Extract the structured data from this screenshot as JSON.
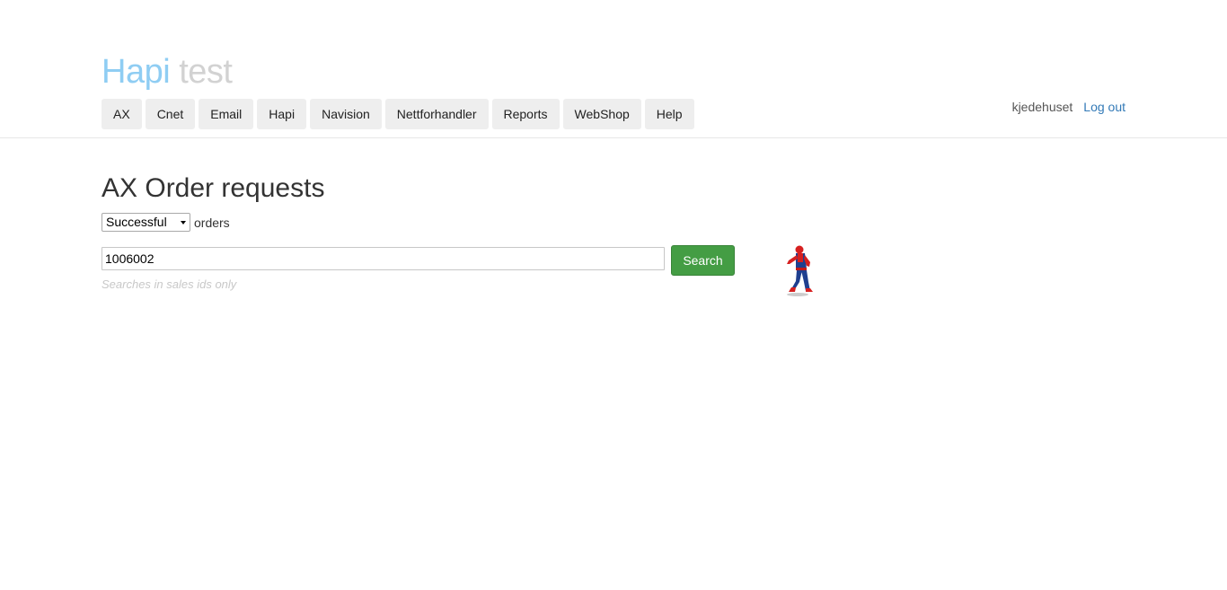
{
  "brand": {
    "primary": "Hapi",
    "secondary": "test"
  },
  "nav": {
    "items": [
      {
        "label": "AX"
      },
      {
        "label": "Cnet"
      },
      {
        "label": "Email"
      },
      {
        "label": "Hapi"
      },
      {
        "label": "Navision"
      },
      {
        "label": "Nettforhandler"
      },
      {
        "label": "Reports"
      },
      {
        "label": "WebShop"
      },
      {
        "label": "Help"
      }
    ]
  },
  "user": {
    "name": "kjedehuset",
    "logout_label": "Log out"
  },
  "page": {
    "title": "AX Order requests"
  },
  "filter": {
    "selected": "Successful",
    "suffix": "orders"
  },
  "search": {
    "value": "1006002",
    "button_label": "Search",
    "help": "Searches in sales ids only"
  },
  "colors": {
    "brand_primary": "#8fcdf3",
    "brand_secondary": "#d2d2d2",
    "link": "#337ab7",
    "search_button": "#449d44"
  },
  "icons": {
    "mascot": "spiderman-figure"
  }
}
